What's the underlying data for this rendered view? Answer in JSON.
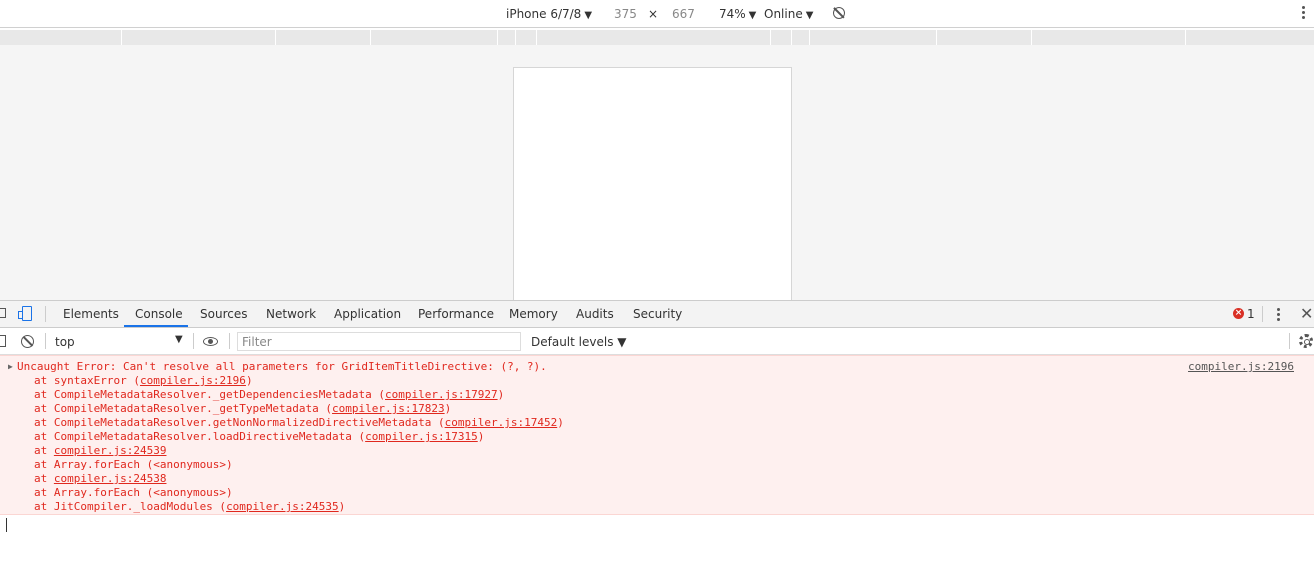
{
  "device_toolbar": {
    "device": "iPhone 6/7/8",
    "width": "375",
    "times": "×",
    "height": "667",
    "zoom": "74%",
    "throttle": "Online",
    "caret": "▼"
  },
  "devtools": {
    "tabs": [
      "Elements",
      "Console",
      "Sources",
      "Network",
      "Application",
      "Performance",
      "Memory",
      "Audits",
      "Security"
    ],
    "active_tab": "Console",
    "error_badge": "×",
    "error_count": "1",
    "close": "✕"
  },
  "console_toolbar": {
    "context": "top",
    "caret": "▼",
    "filter_placeholder": "Filter",
    "levels": "Default levels ▼"
  },
  "error": {
    "expand": "▶",
    "message": "Uncaught Error: Can't resolve all parameters for GridItemTitleDirective: (?, ?).",
    "source": "compiler.js:2196",
    "stack": [
      {
        "prefix": "at syntaxError (",
        "link": "compiler.js:2196",
        "suffix": ")"
      },
      {
        "prefix": "at CompileMetadataResolver._getDependenciesMetadata (",
        "link": "compiler.js:17927",
        "suffix": ")"
      },
      {
        "prefix": "at CompileMetadataResolver._getTypeMetadata (",
        "link": "compiler.js:17823",
        "suffix": ")"
      },
      {
        "prefix": "at CompileMetadataResolver.getNonNormalizedDirectiveMetadata (",
        "link": "compiler.js:17452",
        "suffix": ")"
      },
      {
        "prefix": "at CompileMetadataResolver.loadDirectiveMetadata (",
        "link": "compiler.js:17315",
        "suffix": ")"
      },
      {
        "prefix": "at ",
        "link": "compiler.js:24539",
        "suffix": ""
      },
      {
        "prefix": "at Array.forEach (<anonymous>)",
        "link": "",
        "suffix": ""
      },
      {
        "prefix": "at ",
        "link": "compiler.js:24538",
        "suffix": ""
      },
      {
        "prefix": "at Array.forEach (<anonymous>)",
        "link": "",
        "suffix": ""
      },
      {
        "prefix": "at JitCompiler._loadModules (",
        "link": "compiler.js:24535",
        "suffix": ")"
      }
    ]
  },
  "colors": {
    "error_text": "#e0281e",
    "error_bg": "#fef0ef",
    "accent": "#1a73e8"
  }
}
